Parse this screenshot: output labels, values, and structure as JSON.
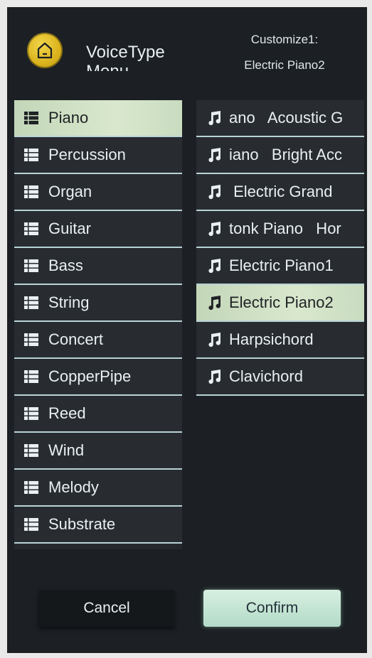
{
  "header": {
    "title": "VoiceType Menu",
    "customize_label": "Customize1:",
    "customize_value": "Electric Piano2"
  },
  "categories": [
    {
      "label": "Piano",
      "selected": true
    },
    {
      "label": "Percussion",
      "selected": false
    },
    {
      "label": "Organ",
      "selected": false
    },
    {
      "label": "Guitar",
      "selected": false
    },
    {
      "label": "Bass",
      "selected": false
    },
    {
      "label": "String",
      "selected": false
    },
    {
      "label": "Concert",
      "selected": false
    },
    {
      "label": "CopperPipe",
      "selected": false
    },
    {
      "label": "Reed",
      "selected": false
    },
    {
      "label": "Wind",
      "selected": false
    },
    {
      "label": "Melody",
      "selected": false
    },
    {
      "label": "Substrate",
      "selected": false
    }
  ],
  "voices": [
    {
      "label": "ano   Acoustic G",
      "selected": false
    },
    {
      "label": "iano   Bright Acc",
      "selected": false
    },
    {
      "label": " Electric Grand",
      "selected": false
    },
    {
      "label": "tonk Piano   Hor",
      "selected": false
    },
    {
      "label": "Electric Piano1",
      "selected": false
    },
    {
      "label": "Electric Piano2",
      "selected": true
    },
    {
      "label": "Harpsichord",
      "selected": false
    },
    {
      "label": "Clavichord",
      "selected": false
    }
  ],
  "buttons": {
    "cancel": "Cancel",
    "confirm": "Confirm"
  },
  "icons": {
    "home": "home-icon",
    "category": "list-icon",
    "voice": "music-note-icon"
  },
  "colors": {
    "background": "#1c2024",
    "selected_item": "#d9e8cd",
    "divider": "#b9d3d6",
    "accent_yellow": "#d9b21c"
  }
}
